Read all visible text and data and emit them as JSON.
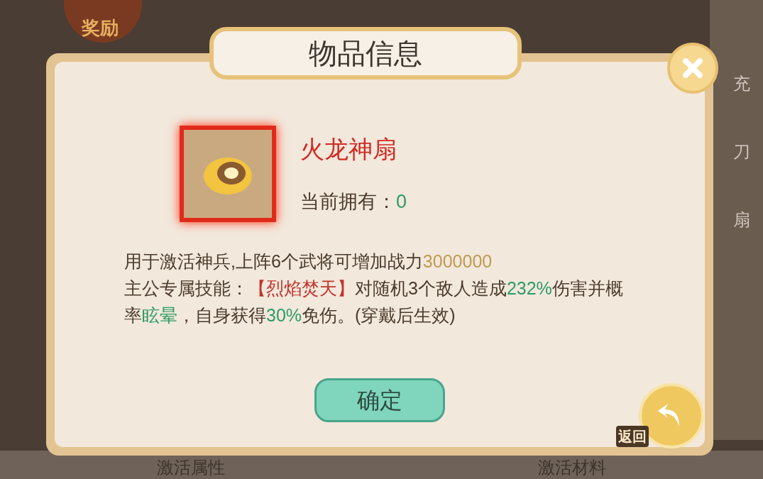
{
  "background": {
    "reward_label": "奖励",
    "side_labels": [
      "充",
      "刀",
      "扇"
    ],
    "bottom_tabs": [
      "激活属性",
      "激活材料"
    ]
  },
  "dialog": {
    "title": "物品信息",
    "item": {
      "name": "火龙神扇",
      "owned_label": "当前拥有：",
      "owned_count": "0"
    },
    "description": [
      [
        {
          "text": "用于激活神兵,上阵6个武将可增加战力",
          "color": "#4a3b2c"
        },
        {
          "text": "3000000",
          "color": "#c09a52"
        }
      ],
      [
        {
          "text": "主公专属技能：",
          "color": "#4a3b2c"
        },
        {
          "text": "【烈焰焚天】",
          "color": "#c0332b"
        },
        {
          "text": "对随机3个敌人造成",
          "color": "#4a3b2c"
        },
        {
          "text": "232%",
          "color": "#2e9c64"
        },
        {
          "text": "伤害并概率",
          "color": "#4a3b2c"
        },
        {
          "text": "眩晕",
          "color": "#2e9c64"
        },
        {
          "text": "，自身获得",
          "color": "#4a3b2c"
        },
        {
          "text": "30%",
          "color": "#2e9c64"
        },
        {
          "text": "免伤。(穿戴后生效)",
          "color": "#4a3b2c"
        }
      ]
    ],
    "confirm_button": "确定",
    "back_label": "返回"
  }
}
